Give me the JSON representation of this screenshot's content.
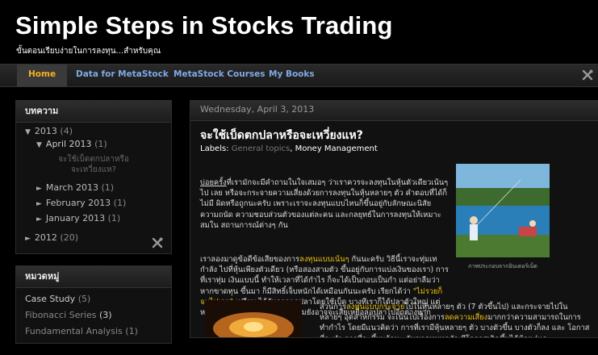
{
  "header": {
    "title": "Simple Steps in Stocks Trading",
    "description": "ขั้นตอนเรียบง่ายในการลงทุน...สำหรับคุณ"
  },
  "tabs": [
    "Home",
    "Data for MetaStock",
    "MetaStock Courses",
    "My Books"
  ],
  "sidebar": {
    "archive_title": "บทความ",
    "archive": [
      {
        "label": "2013",
        "count": "(4)",
        "state": "open"
      },
      {
        "label": "April 2013",
        "count": "(1)",
        "state": "open"
      },
      {
        "label": "March 2013",
        "count": "(1)",
        "state": "closed"
      },
      {
        "label": "February 2013",
        "count": "(1)",
        "state": "closed"
      },
      {
        "label": "January 2013",
        "count": "(1)",
        "state": "closed"
      },
      {
        "label": "2012",
        "count": "(20)",
        "state": "closed"
      }
    ],
    "archive_post": "จะใช้เบ็ดตกปลาหรือจะเหวี่ยงแห?",
    "labels_title": "หมวดหมู่",
    "labels": [
      {
        "name": "Case Study",
        "count": "(5)"
      },
      {
        "name": "Fibonacci Series",
        "count": "(3)"
      },
      {
        "name": "Fundamental Analysis",
        "count": "(1)"
      }
    ]
  },
  "post": {
    "date": "Wednesday, April 3, 2013",
    "title": "จะใช้เบ็ดตกปลาหรือจะเหวี่ยงแห?",
    "labels_prefix": "Labels:",
    "label_1": "General topics",
    "label_sep": ",",
    "label_2": "Money Management",
    "p1_a": "บ่อยครั้ง",
    "p1_b": "ที่เรามักจะมีคำถามในใจเสมอๆ ว่าเราควรจะลงทุนในหุ้นตัวเดียวเน้นๆ ไป เลย หรือจะกระจายความเสี่ยงด้วยการลงทุนในหุ้นหลายๆ ตัว คำตอบที่ได้ก็ไม่มี ผิดหรือถูกนะครับ เพราะเราจะลงทุนแบบไหนก็ขึ้นอยู่กับลักษณะนิสัย ความถนัด ความชอบส่วนตัวของแต่ละคน และกลยุทธ์ในการลงทุนให้เหมาะสมใน สถานการณ์ต่างๆ กัน",
    "p2_a": "เราลองมาดูข้อดีข้อเสียของการ",
    "p2_hl1": "ลงทุนแบบเน้นๆ",
    "p2_b": " กันนะครับ วิธีนี้เราจะทุ่มเทกำลัง ไปที่หุ้นเพียงตัวเดียว (หรือสองสามตัว ขึ้นอยู่กับการแบ่งเงินของเรา) การที่เราทุ่ม เงินแบบนี้ ทำให้เวลาที่ได้กำไร ก็จะได้เป็นกอบเป็นกำ แต่อย่าลืมว่า หากขาดทุน ขึ้นมา ก็มีสิทธิ์เจ็บหนักได้เหมือนกันนะครับ เรียกได้ว่า ",
    "p2_hl2": "\"ไม่รวยก็จนไปเลย\"",
    "p2_c": " เปรียบ ได้กับการตกปลาโดยใช้เบ็ด บางทีเราก็ได้ปลาตัวใหญ่ แต่หลายครั้งก็ตกปลาไม่ ได้เลย แถมยังอาจจะเสียเหยื่อล่อปลาไปอีกต่างหาก",
    "p3_a": "ส่วนการ",
    "p3_hl1": "ลงทุนแบบกระจาย",
    "p3_b": "ไปในหุ้นหลายๆ ตัว (7 ตัวขึ้นไป) และกระจายไปใน หลายๆ อุตสาหกรรม จะเน้นไปเรื่องการ",
    "p3_hl2": "ลดความเสี่ยง",
    "p3_c": "มากกว่าความสามารถในการ ทำกำไร โดยมีแนวคิดว่า การที่เรามีหุ้นหลายๆ ตัว บางตัวขึ้น บางตัวก็ลง และ โอกาสที่จะทำ การที่จะขึ้นพร้อมๆ กันขาดทุนทุกตัว มีโอกาสเกิดขึ้นได้น้อย (และ",
    "photo_caption": "ภาพประกอบจากอินเตอร์เน็ต"
  },
  "colors": {
    "accent_tab": "#f6b31f",
    "link": "#7fa9e6",
    "highlight": "#f1c40f"
  }
}
